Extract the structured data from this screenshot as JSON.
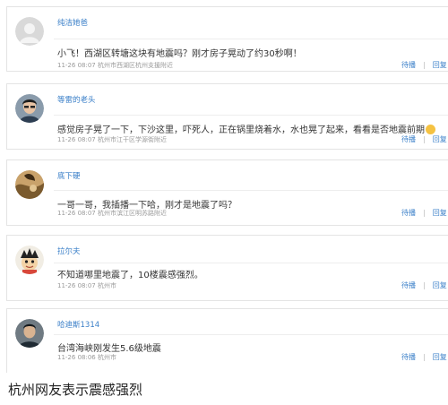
{
  "comments": [
    {
      "username": "纯洁她爸",
      "avatar": "default-avatar-icon",
      "text": "小飞！西湖区转塘这块有地震吗？刚才房子晃动了约30秒啊！",
      "time": "11-26 08:07",
      "location": "杭州市西湖区杭州支援附近",
      "actions": [
        "待播",
        "回复"
      ]
    },
    {
      "username": "等雷的老头",
      "avatar": "man-avatar-icon",
      "text": "感觉房子晃了一下，下沙这里，吓死人，正在锅里烧着水，水也晃了起来，看看是否地震前期",
      "time": "11-26 08:07",
      "location": "杭州市江干区学源街附近",
      "actions": [
        "待播",
        "回复"
      ]
    },
    {
      "username": "底下硬",
      "avatar": "photo-avatar-icon",
      "text": "一哥一哥，我插播一下哈，刚才是地震了吗？",
      "time": "11-26 08:07",
      "location": "杭州市滨江区明苏路附近",
      "actions": [
        "待播",
        "回复"
      ]
    },
    {
      "username": "拉尔夫",
      "avatar": "cartoon-avatar-icon",
      "text": "不知道哪里地震了，10楼震感强烈。",
      "time": "11-26 08:07",
      "location": "杭州市",
      "actions": [
        "待播",
        "回复"
      ]
    },
    {
      "username": "哈迪斯1314",
      "avatar": "portrait-avatar-icon",
      "text": "台湾海峡刚发生5.6级地震",
      "time": "11-26 08:06",
      "location": "杭州市",
      "actions": [
        "待播",
        "回复"
      ]
    }
  ],
  "caption": "杭州网友表示震感强烈",
  "colors": {
    "link": "#3a7fc8",
    "meta": "#9a9a9a",
    "text": "#333333"
  }
}
